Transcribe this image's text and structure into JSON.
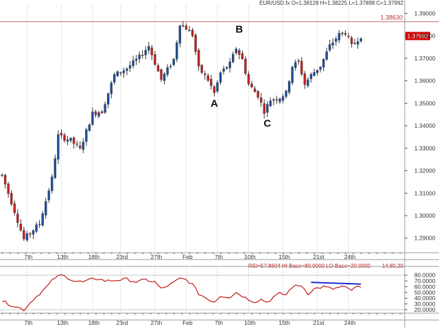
{
  "chart_data": [
    {
      "type": "candlestick",
      "symbol": "EUR/USD.fx",
      "ohlc_label": "O=1.38128 H=1.38225 L=1.37898 C=1.37992",
      "title": "EUR/USD.fx O=1.38128 H=1.38225 L=1.37898 C=1.37992",
      "ylim": [
        1.2835,
        1.3935
      ],
      "y_ticks": [
        "1.39000",
        "1.38000",
        "1.37000",
        "1.36000",
        "1.35000",
        "1.34000",
        "1.33000",
        "1.32000",
        "1.31000",
        "1.30000",
        "1.29000"
      ],
      "y_tick_values": [
        1.39,
        1.38,
        1.37,
        1.36,
        1.35,
        1.34,
        1.33,
        1.32,
        1.31,
        1.3,
        1.29
      ],
      "x_ticks": [
        "7th",
        "13th",
        "18th",
        "23rd",
        "27th",
        "Feb",
        "7th",
        "10th",
        "15th",
        "21st",
        "24th"
      ],
      "x_tick_index": [
        8,
        19,
        29,
        38,
        49,
        59,
        69,
        79,
        90,
        101,
        111
      ],
      "resistance_level": 1.3863,
      "resistance_label": "1.38630",
      "last_price": 1.37992,
      "last_price_label": "1.37992",
      "annotations": [
        {
          "text": "A",
          "index": 68,
          "value": 1.3485
        },
        {
          "text": "B",
          "index": 76,
          "value": 1.3815
        },
        {
          "text": "C",
          "index": 85,
          "value": 1.3395
        }
      ],
      "colors": {
        "up": "#1f4e9c",
        "down": "#c8201e",
        "wick": "#333333",
        "resistance": "#c07070",
        "last_price_bg": "#d40000"
      },
      "anchors": [
        [
          0,
          1.318
        ],
        [
          4,
          1.302
        ],
        [
          7,
          1.2895
        ],
        [
          12,
          1.2965
        ],
        [
          16,
          1.3165
        ],
        [
          18,
          1.3355
        ],
        [
          22,
          1.3335
        ],
        [
          25,
          1.3295
        ],
        [
          29,
          1.3455
        ],
        [
          32,
          1.3465
        ],
        [
          36,
          1.3625
        ],
        [
          40,
          1.3655
        ],
        [
          44,
          1.3705
        ],
        [
          47,
          1.3755
        ],
        [
          51,
          1.3605
        ],
        [
          55,
          1.3695
        ],
        [
          57,
          1.3855
        ],
        [
          59,
          1.3835
        ],
        [
          61,
          1.3805
        ],
        [
          63,
          1.3655
        ],
        [
          66,
          1.3605
        ],
        [
          68,
          1.3545
        ],
        [
          70,
          1.3635
        ],
        [
          73,
          1.3675
        ],
        [
          75,
          1.3745
        ],
        [
          77,
          1.3695
        ],
        [
          79,
          1.3585
        ],
        [
          82,
          1.3535
        ],
        [
          84,
          1.3465
        ],
        [
          86,
          1.3515
        ],
        [
          89,
          1.3525
        ],
        [
          91,
          1.3545
        ],
        [
          93,
          1.3665
        ],
        [
          95,
          1.3685
        ],
        [
          97,
          1.3585
        ],
        [
          99,
          1.3625
        ],
        [
          102,
          1.3665
        ],
        [
          105,
          1.3755
        ],
        [
          108,
          1.3805
        ],
        [
          110,
          1.3815
        ],
        [
          112,
          1.3755
        ],
        [
          114,
          1.3785
        ],
        [
          115,
          1.3799
        ]
      ]
    },
    {
      "type": "line",
      "label": "RSI=57.8604  HI Base=80.0000  LO Base=20.0000",
      "levels_label": "14,80,20",
      "ylim": [
        14,
        88
      ],
      "y_ticks": [
        "80.0000",
        "70.0000",
        "60.0000",
        "50.0000",
        "40.0000",
        "30.0000",
        "20.0000"
      ],
      "y_tick_values": [
        80,
        70,
        60,
        50,
        40,
        30,
        20
      ],
      "x_ticks": [
        "7th",
        "13th",
        "18th",
        "23rd",
        "27th",
        "Feb",
        "7th",
        "10th",
        "15th",
        "21st",
        "24th"
      ],
      "trendline": [
        [
          99,
          67.5
        ],
        [
          115,
          64.5
        ]
      ],
      "colors": {
        "line": "#c01818",
        "trendline": "#1a2ed0"
      },
      "anchors": [
        [
          0,
          35
        ],
        [
          3,
          28
        ],
        [
          7,
          20
        ],
        [
          10,
          38
        ],
        [
          14,
          58
        ],
        [
          17,
          76
        ],
        [
          19,
          80
        ],
        [
          21,
          76
        ],
        [
          23,
          70
        ],
        [
          26,
          68
        ],
        [
          29,
          73
        ],
        [
          31,
          74
        ],
        [
          33,
          70
        ],
        [
          36,
          71
        ],
        [
          40,
          73
        ],
        [
          43,
          68
        ],
        [
          46,
          72
        ],
        [
          49,
          68
        ],
        [
          51,
          56
        ],
        [
          54,
          64
        ],
        [
          57,
          74
        ],
        [
          59,
          72
        ],
        [
          61,
          64
        ],
        [
          63,
          48
        ],
        [
          66,
          38
        ],
        [
          68,
          34
        ],
        [
          70,
          44
        ],
        [
          73,
          42
        ],
        [
          75,
          50
        ],
        [
          77,
          44
        ],
        [
          79,
          38
        ],
        [
          81,
          34
        ],
        [
          83,
          38
        ],
        [
          85,
          33
        ],
        [
          87,
          42
        ],
        [
          89,
          48
        ],
        [
          91,
          46
        ],
        [
          93,
          60
        ],
        [
          96,
          62
        ],
        [
          98,
          48
        ],
        [
          100,
          56
        ],
        [
          103,
          60
        ],
        [
          106,
          56
        ],
        [
          109,
          60
        ],
        [
          112,
          54
        ],
        [
          114,
          60
        ],
        [
          115,
          57.86
        ]
      ]
    }
  ]
}
